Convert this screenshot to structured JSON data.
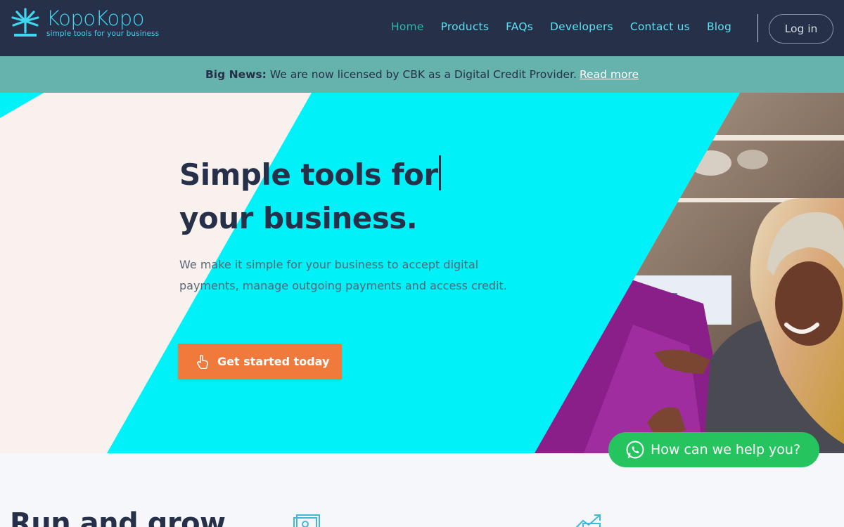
{
  "brand": {
    "name": "KopoKopo",
    "tagline": "simple tools for your business",
    "accent": "#41d6f0"
  },
  "nav": {
    "items": [
      {
        "label": "Home",
        "active": true
      },
      {
        "label": "Products"
      },
      {
        "label": "FAQs"
      },
      {
        "label": "Developers"
      },
      {
        "label": "Contact us"
      },
      {
        "label": "Blog"
      }
    ],
    "login_label": "Log in"
  },
  "banner": {
    "bold": "Big News:",
    "text": "We are now licensed by CBK as a Digital Credit Provider.",
    "link": "Read more"
  },
  "hero": {
    "title_line1": "Simple tools for",
    "title_line2": "your business.",
    "description": "We make it simple for your business to accept digital payments, manage outgoing payments and access credit.",
    "cta_label": "Get started today",
    "cta_icon": "pointer-hand-icon"
  },
  "whatsapp": {
    "label": "How can we help you?",
    "icon": "whatsapp-icon",
    "color": "#25c45f"
  },
  "section": {
    "title": "Run and grow"
  },
  "colors": {
    "header": "#263048",
    "banner": "#66b2ac",
    "cyan": "#00f2f8",
    "cta": "#f07a3c"
  }
}
